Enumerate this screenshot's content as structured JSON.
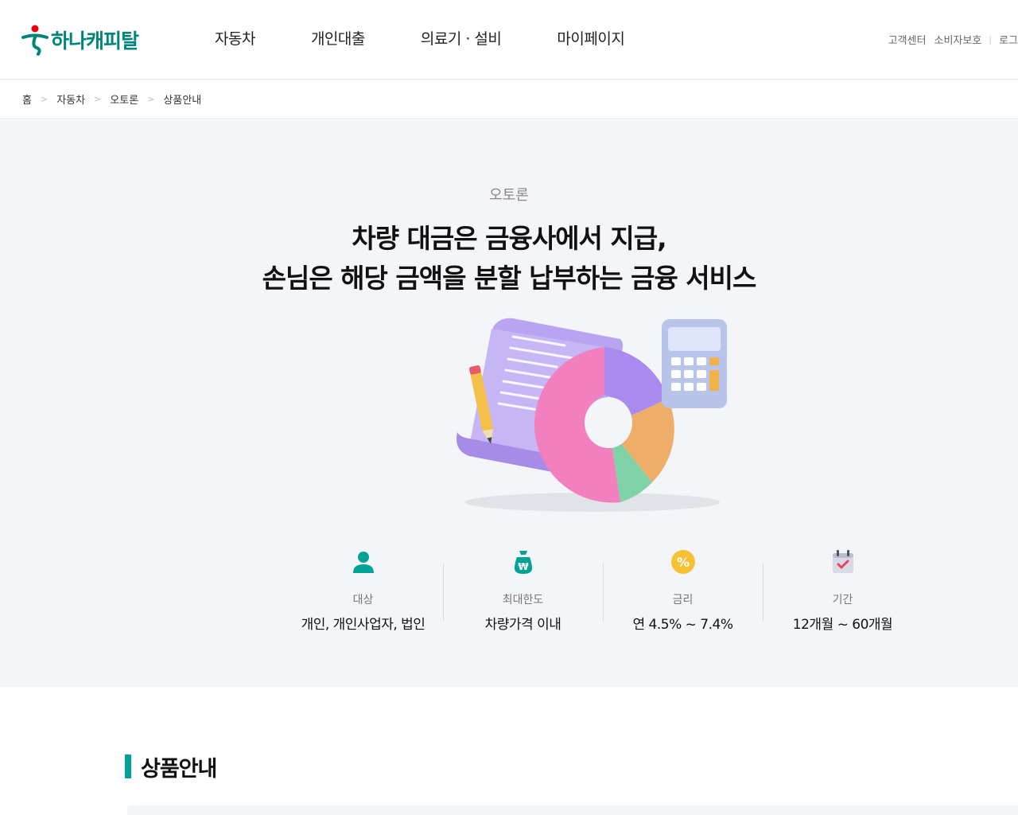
{
  "header": {
    "logo_text": "하나캐피탈",
    "nav": [
      "자동차",
      "개인대출",
      "의료기 · 설비",
      "마이페이지"
    ],
    "util": {
      "customer_center": "고객센터",
      "consumer_protection": "소비자보호",
      "login": "로그"
    }
  },
  "breadcrumb": [
    "홈",
    "자동차",
    "오토론",
    "상품안내"
  ],
  "hero": {
    "eyebrow": "오토론",
    "title_line1": "차량 대금은 금융사에서 지급,",
    "title_line2": "손님은 해당 금액을 분할 납부하는 금융 서비스"
  },
  "infos": [
    {
      "icon": "person-icon",
      "label": "대상",
      "value": "개인, 개인사업자, 법인"
    },
    {
      "icon": "money-bag-won-icon",
      "label": "최대한도",
      "value": "차량가격 이내"
    },
    {
      "icon": "percent-icon",
      "label": "금리",
      "value": "연 4.5% ~ 7.4%"
    },
    {
      "icon": "calendar-check-icon",
      "label": "기간",
      "value": "12개월 ~ 60개월"
    }
  ],
  "section": {
    "title": "상품안내"
  },
  "colors": {
    "brand": "#00857a",
    "accent": "#00a396",
    "hero_bg": "#f4f5f8",
    "logo_red": "#e60012"
  }
}
